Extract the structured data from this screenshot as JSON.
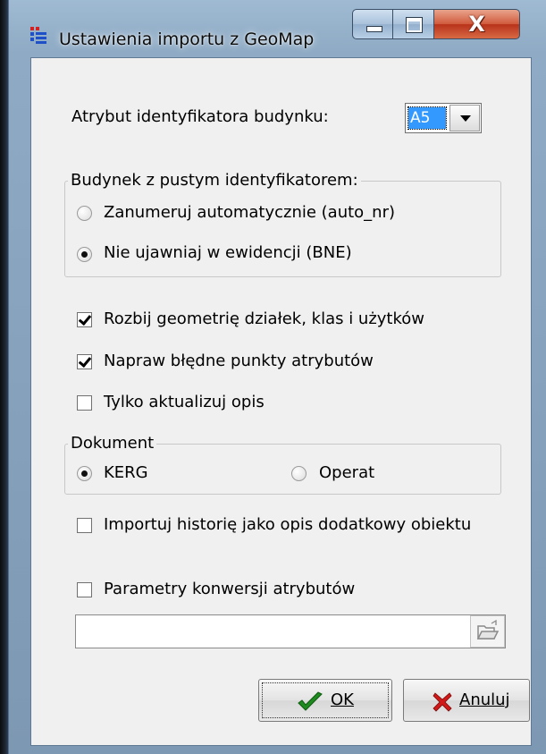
{
  "window": {
    "title": "Ustawienia importu z GeoMap",
    "close_glyph": "X"
  },
  "building_id": {
    "label": "Atrybut identyfikatora budynku:",
    "selected": "A5"
  },
  "empty_id_group": {
    "caption": "Budynek z pustym identyfikatorem:",
    "options": [
      {
        "label": "Zanumeruj automatycznie (auto_nr)",
        "selected": false
      },
      {
        "label": "Nie ujawniaj w ewidencji (BNE)",
        "selected": true
      }
    ]
  },
  "checkboxes": [
    {
      "label": "Rozbij geometrię działek, klas i użytków",
      "checked": true
    },
    {
      "label": "Napraw błędne punkty atrybutów",
      "checked": true
    },
    {
      "label": "Tylko aktualizuj opis",
      "checked": false
    }
  ],
  "document_group": {
    "caption": "Dokument",
    "options": [
      {
        "label": "KERG",
        "selected": true
      },
      {
        "label": "Operat",
        "selected": false
      }
    ]
  },
  "import_history": {
    "label": "Importuj historię jako opis dodatkowy obiektu",
    "checked": false
  },
  "conversion_params": {
    "label": "Parametry konwersji atrybutów",
    "checked": false,
    "path_value": ""
  },
  "buttons": {
    "ok": "OK",
    "cancel": "Anuluj"
  },
  "icons": {
    "app": "app-grid-icon",
    "browse": "folder-open-icon",
    "ok": "checkmark-icon",
    "cancel": "red-x-icon"
  },
  "colors": {
    "selection": "#3399ff",
    "ok_icon": "#1f8a1f",
    "cancel_icon": "#d01818",
    "close_button": "#c8432a"
  }
}
